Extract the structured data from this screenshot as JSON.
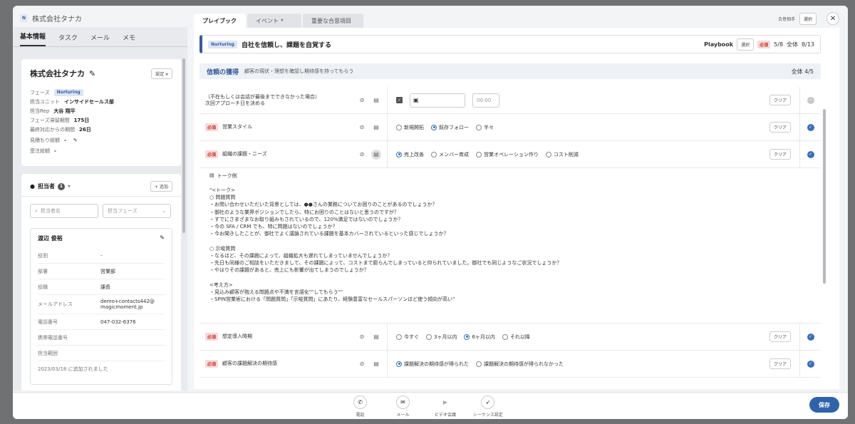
{
  "company": {
    "logo_letter": "N",
    "name": "株式会社タナカ"
  },
  "tabs": [
    {
      "label": "プレイブック"
    },
    {
      "label": "イベント"
    },
    {
      "label": "重要な合意項目"
    }
  ],
  "top_right": {
    "agreement_partner": "合意相手",
    "select": "選択"
  },
  "left_tabs": [
    "基本情報",
    "タスク",
    "メール",
    "メモ"
  ],
  "company_card": {
    "title": "株式会社タナカ",
    "settings": "設定",
    "fields": [
      {
        "k": "フェーズ",
        "v": "Nurturing"
      },
      {
        "k": "担当ユニット",
        "v": "インサイドセールス部"
      },
      {
        "k": "担当Rep",
        "v": "大谷 翔平"
      },
      {
        "k": "フェーズ滞留期間",
        "v": "175日"
      },
      {
        "k": "最終対応からの期間",
        "v": "26日"
      },
      {
        "k": "見積もり総額",
        "v": "-"
      },
      {
        "k": "受注総額",
        "v": "-"
      }
    ]
  },
  "owners": {
    "title": "担当者",
    "count": "1",
    "add": "追加",
    "search_placeholder": "担当者名",
    "phase_placeholder": "担当フェーズ",
    "contact": {
      "name": "渡辺 俊裕",
      "rows": [
        {
          "k": "役割",
          "v": "-"
        },
        {
          "k": "部署",
          "v": "営業部"
        },
        {
          "k": "役職",
          "v": "課長"
        },
        {
          "k": "メールアドレス",
          "v": "demo+contacts442@\nmagicmoment.jp"
        },
        {
          "k": "電話番号",
          "v": "047-032-6376"
        },
        {
          "k": "携帯電話番号",
          "v": ""
        },
        {
          "k": "担当範囲",
          "v": ""
        }
      ],
      "added": "2023/03/18 に追加されました"
    }
  },
  "playbook": {
    "phase": "Nurturing",
    "title": "自社を信頼し、課題を自覚する",
    "label": "Playbook",
    "select": "選択",
    "required": "必須",
    "required_progress": "5/8",
    "total_label": "全体",
    "total_progress": "8/13"
  },
  "section": {
    "title": "信頼の獲得",
    "desc": "顧客の現状・理想を確認し期待感を持ってもらう",
    "total": "全体 4/5"
  },
  "rows": [
    {
      "label": "（不在もしくは会話が最後までできなかった場合）\n次回アプローチ日を決める",
      "required": false,
      "time_placeholder": "00:00",
      "clear": "クリア",
      "done": false
    },
    {
      "label": "営業スタイル",
      "required": true,
      "options": [
        "新規開拓",
        "既存フォロー",
        "半々"
      ],
      "selected": 1,
      "clear": "クリア",
      "done": true
    },
    {
      "label": "組織の課題・ニーズ",
      "required": true,
      "options": [
        "売上改善",
        "メンバー育成",
        "営業オペレーション作り",
        "コスト削減"
      ],
      "selected": 0,
      "clear": "クリア",
      "done": true
    },
    {
      "label": "想定導入時期",
      "required": true,
      "options": [
        "今すぐ",
        "3ヶ月以内",
        "6ヶ月以内",
        "それ以降"
      ],
      "selected": 2,
      "clear": "クリア",
      "done": true
    },
    {
      "label": "顧客の課題解決の期待感",
      "required": true,
      "options": [
        "課題解決の期待感が得られた",
        "課題解決の期待感が得られなかった"
      ],
      "selected": 0,
      "clear": "クリア",
      "done": true
    }
  ],
  "required_tag": "必須",
  "talk": {
    "title": "トーク例",
    "body": "\"<トーク>\n○ 問題質問\n・お問い合わせいただいた背景としては、●●さんの業務についてお困りのことがあるのでしょうか？\n・御社のような業界ポジションでしたら、特にお困りのことはないと思うのですが？\n・すでにさまざまなお取り組みもされているので、120%満足ではないのでしょうか？\n・今の SFA / CRM でも、特に問題はないのでしょうか？\n・今お聞きしたことが、御社でよく議論されている課題を基本カバーされているといった感じでしょうか？\n\n○ 示唆質問\n・なるほど、その課題によって、組織拡大も遅れてしまっていませんでしょうか？\n・先日も同様のご相談をいただきまして、その課題によって、コストまで膨らんでしまっていると仰られていました。御社でも同じようなご状況でしょうか？\n・やはりその課題があると、売上にも影響が出てしまうのでしょうか？\n\n<考え方>\n・見込み顧客が抱える問題点や不満を言語化\"\"してもらう\"\"\n・SPIN営業術における「問題質問」「示唆質問」にあたり、経験豊富なセールスパーソンほど使う傾向が高い\""
  },
  "bottom": {
    "actions": [
      {
        "label": "電話",
        "icon": "phone-icon"
      },
      {
        "label": "メール",
        "icon": "mail-icon"
      },
      {
        "label": "ビデオ会議",
        "icon": "video-icon"
      },
      {
        "label": "シーケンス設定",
        "icon": "rocket-icon"
      }
    ],
    "save": "保存"
  }
}
